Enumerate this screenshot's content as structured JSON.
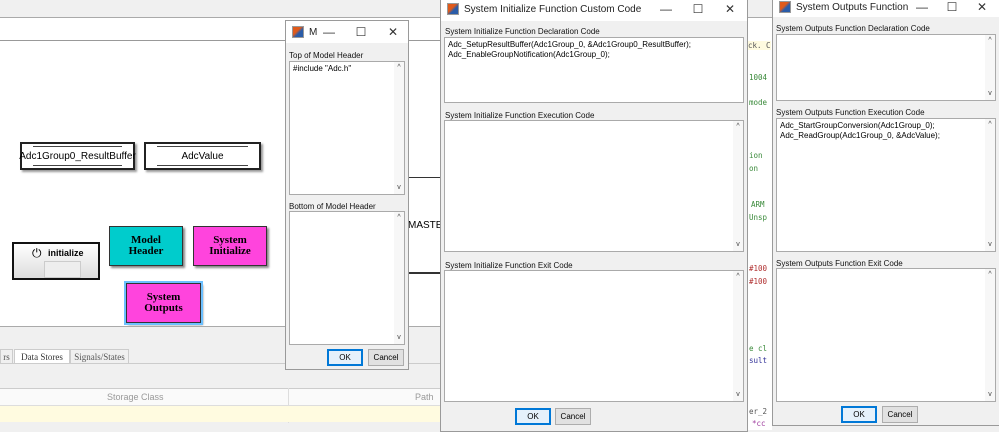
{
  "canvas": {
    "blocks": {
      "result_buffer": "Adc1Group0_ResultBuffer",
      "adc_value": "AdcValue",
      "initialize": "initialize",
      "model_header": "Model Header",
      "system_initialize": "System Initialize",
      "system_outputs": "System Outputs",
      "master": "MASTER"
    },
    "colors": {
      "cyan": "#00cccc",
      "magenta": "#ff44dd"
    }
  },
  "bottom_panel": {
    "tabs": [
      "rs",
      "Data Stores",
      "Signals/States"
    ],
    "columns": [
      "Storage Class",
      "Path"
    ]
  },
  "code_fragments": [
    "ck. C",
    "1004",
    "mode",
    "ion",
    "on",
    "ARM",
    "Unsp",
    "#100",
    "#100",
    "e cl",
    "sult",
    "er_2",
    "*cc"
  ],
  "dialog_header": {
    "title": "M",
    "top_label": "Top of Model Header",
    "top_value": "#include \"Adc.h\"",
    "bottom_label": "Bottom of Model Header",
    "bottom_value": "",
    "ok": "OK",
    "cancel": "Cancel"
  },
  "dialog_init": {
    "title": "System Initialize Function Custom Code",
    "decl_label": "System Initialize Function Declaration Code",
    "decl_value": "Adc_SetupResultBuffer(Adc1Group_0, &Adc1Group0_ResultBuffer);\nAdc_EnableGroupNotification(Adc1Group_0);",
    "exec_label": "System Initialize Function Execution Code",
    "exec_value": "",
    "exit_label": "System Initialize Function Exit Code",
    "exit_value": "",
    "ok": "OK",
    "cancel": "Cancel"
  },
  "dialog_outputs": {
    "title": "System Outputs Function C...",
    "decl_label": "System Outputs Function Declaration Code",
    "decl_value": "",
    "exec_label": "System Outputs Function Execution Code",
    "exec_value": "Adc_StartGroupConversion(Adc1Group_0);\nAdc_ReadGroup(Adc1Group_0, &AdcValue);",
    "exit_label": "System Outputs Function Exit Code",
    "exit_value": "",
    "ok": "OK",
    "cancel": "Cancel"
  }
}
